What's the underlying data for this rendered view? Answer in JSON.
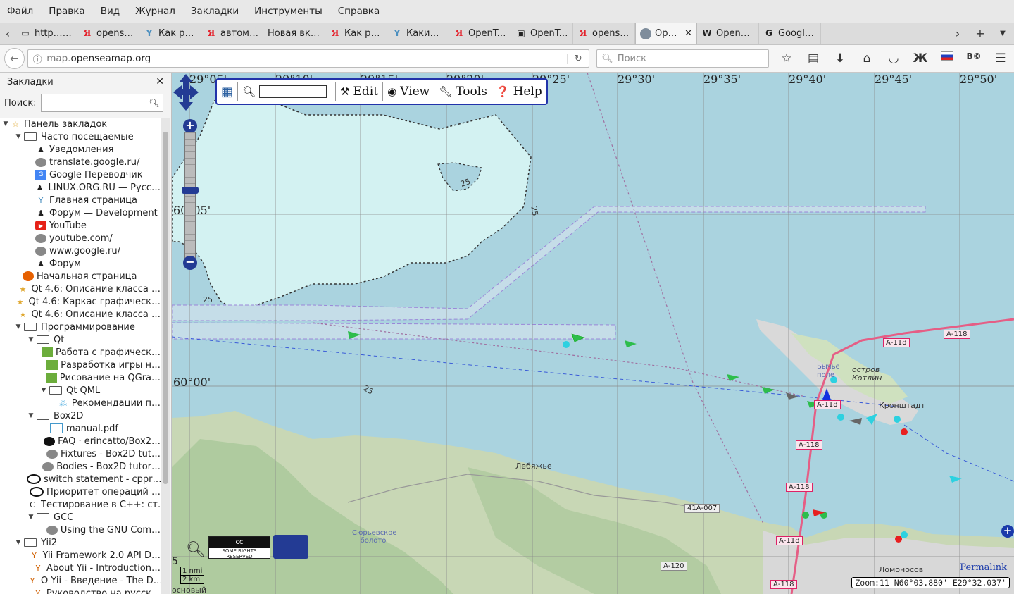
{
  "menubar": [
    "Файл",
    "Правка",
    "Вид",
    "Журнал",
    "Закладки",
    "Инструменты",
    "Справка"
  ],
  "tabs": [
    {
      "label": "http…806",
      "icon": "folder-icon"
    },
    {
      "label": "openstr…",
      "icon": "yandex-icon"
    },
    {
      "label": "Как раб…",
      "icon": "y-icon"
    },
    {
      "label": "автома…",
      "icon": "yandex-icon"
    },
    {
      "label": "Новая вкла…",
      "icon": ""
    },
    {
      "label": "Как раб…",
      "icon": "yandex-icon"
    },
    {
      "label": "Какие о…",
      "icon": "y-icon"
    },
    {
      "label": "OpenTo…",
      "icon": "yandex-icon"
    },
    {
      "label": "OpenTo…",
      "icon": "map-icon"
    },
    {
      "label": "opense…",
      "icon": "yandex-icon"
    },
    {
      "label": "Ope…",
      "icon": "globe-icon",
      "active": true
    },
    {
      "label": "OpenSe…",
      "icon": "wikipedia-icon"
    },
    {
      "label": "Google …",
      "icon": "google-icon"
    }
  ],
  "navbar": {
    "url_domain": "openseamap.org",
    "url_prefix": "map.",
    "search_placeholder": "Поиск",
    "reader_label": "Ж"
  },
  "sidebar": {
    "title": "Закладки",
    "search_label": "Поиск:",
    "items": [
      {
        "label": "Панель закладок",
        "depth": 0,
        "icon": "star-folder",
        "open": true
      },
      {
        "label": "Часто посещаемые",
        "depth": 1,
        "icon": "folder-rss",
        "open": true
      },
      {
        "label": "Уведомления",
        "depth": 2,
        "icon": "linux"
      },
      {
        "label": "translate.google.ru/",
        "depth": 2,
        "icon": "globe"
      },
      {
        "label": "Google Переводчик",
        "depth": 2,
        "icon": "gt"
      },
      {
        "label": "LINUX.ORG.RU — Русс…",
        "depth": 2,
        "icon": "linux"
      },
      {
        "label": "Главная страница",
        "depth": 2,
        "icon": "y"
      },
      {
        "label": "Форум — Development",
        "depth": 2,
        "icon": "linux"
      },
      {
        "label": "YouTube",
        "depth": 2,
        "icon": "yt"
      },
      {
        "label": "youtube.com/",
        "depth": 2,
        "icon": "globe"
      },
      {
        "label": "www.google.ru/",
        "depth": 2,
        "icon": "globe"
      },
      {
        "label": "Форум",
        "depth": 2,
        "icon": "linux"
      },
      {
        "label": "Начальная страница",
        "depth": 1,
        "icon": "ff"
      },
      {
        "label": "Qt 4.6: Описание класса …",
        "depth": 1,
        "icon": "star"
      },
      {
        "label": "Qt 4.6: Каркас графическ…",
        "depth": 1,
        "icon": "star"
      },
      {
        "label": "Qt 4.6: Описание класса …",
        "depth": 1,
        "icon": "star"
      },
      {
        "label": "Программирование",
        "depth": 1,
        "icon": "folder",
        "open": true
      },
      {
        "label": "Qt",
        "depth": 2,
        "icon": "folder",
        "open": true
      },
      {
        "label": "Работа с графическ…",
        "depth": 3,
        "icon": "qt"
      },
      {
        "label": "Разработка игры н…",
        "depth": 3,
        "icon": "qt"
      },
      {
        "label": "Рисование на QGra…",
        "depth": 3,
        "icon": "qt"
      },
      {
        "label": "Qt QML",
        "depth": 3,
        "icon": "folder",
        "open": true
      },
      {
        "label": "Рекомендации п…",
        "depth": 4,
        "icon": "qml"
      },
      {
        "label": "Box2D",
        "depth": 2,
        "icon": "folder",
        "open": true
      },
      {
        "label": "manual.pdf",
        "depth": 3,
        "icon": "pdf"
      },
      {
        "label": "FAQ · erincatto/Box2…",
        "depth": 3,
        "icon": "gh"
      },
      {
        "label": "Fixtures - Box2D tut…",
        "depth": 3,
        "icon": "globe"
      },
      {
        "label": "Bodies - Box2D tutor…",
        "depth": 3,
        "icon": "globe"
      },
      {
        "label": "switch statement - cppr…",
        "depth": 2,
        "icon": "cpp"
      },
      {
        "label": "Приоритет операций …",
        "depth": 2,
        "icon": "cpp"
      },
      {
        "label": "Тестирование в C++: ст…",
        "depth": 2,
        "icon": "cpp2"
      },
      {
        "label": "GCC",
        "depth": 2,
        "icon": "folder",
        "open": true
      },
      {
        "label": "Using the GNU Com…",
        "depth": 3,
        "icon": "globe"
      },
      {
        "label": "Yii2",
        "depth": 1,
        "icon": "folder",
        "open": true
      },
      {
        "label": "Yii Framework 2.0 API D…",
        "depth": 2,
        "icon": "yii"
      },
      {
        "label": "About Yii - Introduction…",
        "depth": 2,
        "icon": "yii"
      },
      {
        "label": "О Yii - Введение - The D…",
        "depth": 2,
        "icon": "yii"
      },
      {
        "label": "Руководство на русск…",
        "depth": 2,
        "icon": "yii"
      }
    ]
  },
  "map": {
    "toolbar": {
      "edit": "Edit",
      "view": "View",
      "tools": "Tools",
      "help": "Help"
    },
    "lon_labels": [
      "29°05'",
      "29°10'",
      "29°15'",
      "29°20'",
      "29°25'",
      "29°30'",
      "29°35'",
      "29°40'",
      "29°45'",
      "29°50'"
    ],
    "lat_labels": [
      "60°05'",
      "60°00'"
    ],
    "places": {
      "kotlin": "остров Котлин",
      "bychye": "Бычье поле",
      "kronstadt": "Кронштадт",
      "lebyazhye": "Лебяжье",
      "lomonosov": "Ломоносов",
      "bog": "Сюрьевское болото"
    },
    "roads": [
      "А-118",
      "А-118",
      "А-118",
      "А-118",
      "А-118",
      "А-118",
      "А-118",
      "41А-007",
      "А-120"
    ],
    "depths": [
      "25",
      "25",
      "25",
      "25"
    ],
    "scale": {
      "nmi": "1 nmi",
      "km": "2 km",
      "zoom_partial": "5"
    },
    "cc_top": "cc",
    "cc_bottom": "SOME RIGHTS RESERVED",
    "permalink": "Permalink",
    "coords": "Zoom:11 N60°03.880' E29°32.037'",
    "bottom_clip": "основый"
  }
}
